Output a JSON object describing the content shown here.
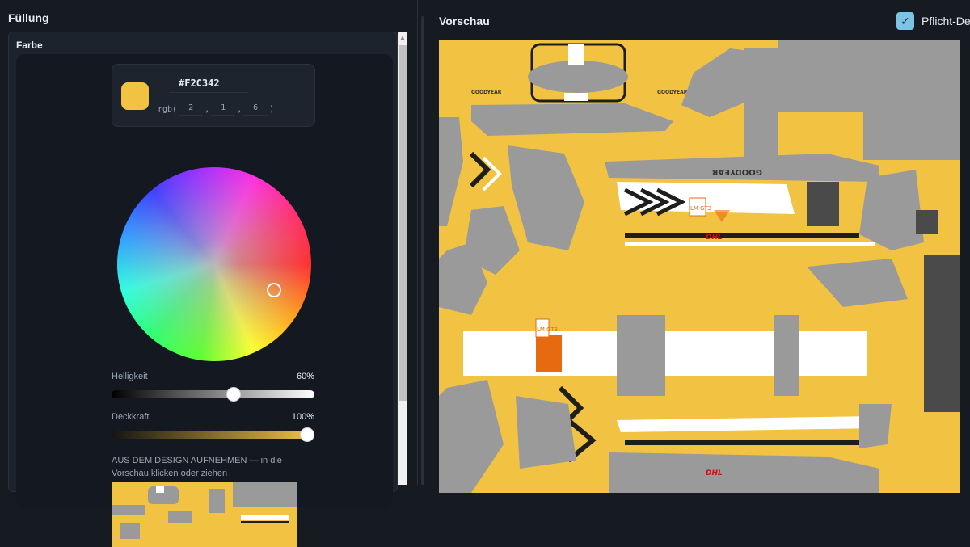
{
  "left_panel": {
    "title": "Füllung",
    "section_title": "Farbe",
    "color": {
      "hex": "#F2C342",
      "rgb_prefix": "rgb(",
      "rgb_r": "2",
      "rgb_g": "1",
      "rgb_b": "6",
      "rgb_suffix": ")",
      "swatch_color": "#F2C342"
    },
    "brightness": {
      "label": "Helligkeit",
      "value_text": "60%",
      "value": 0.6
    },
    "opacity": {
      "label": "Deckkraft",
      "value_text": "100%",
      "value": 1.0
    },
    "pick_hint_strong": "AUS DEM DESIGN AUFNEHMEN",
    "pick_hint_rest": " — in die Vorschau klicken oder ziehen"
  },
  "right_panel": {
    "title": "Vorschau",
    "checkbox_label": "Pflicht-De",
    "checkbox_checked": true,
    "livery_texts": {
      "goodyear": "GOODYEAR",
      "dhl": "DHL",
      "lm_gt3": "LM GT3"
    }
  },
  "colors": {
    "accent_yellow": "#F2C342",
    "panel_bg": "#161b22",
    "checkbox": "#7dc4e4",
    "livery_gray": "#9a9a9a",
    "livery_orange": "#e86a10"
  }
}
